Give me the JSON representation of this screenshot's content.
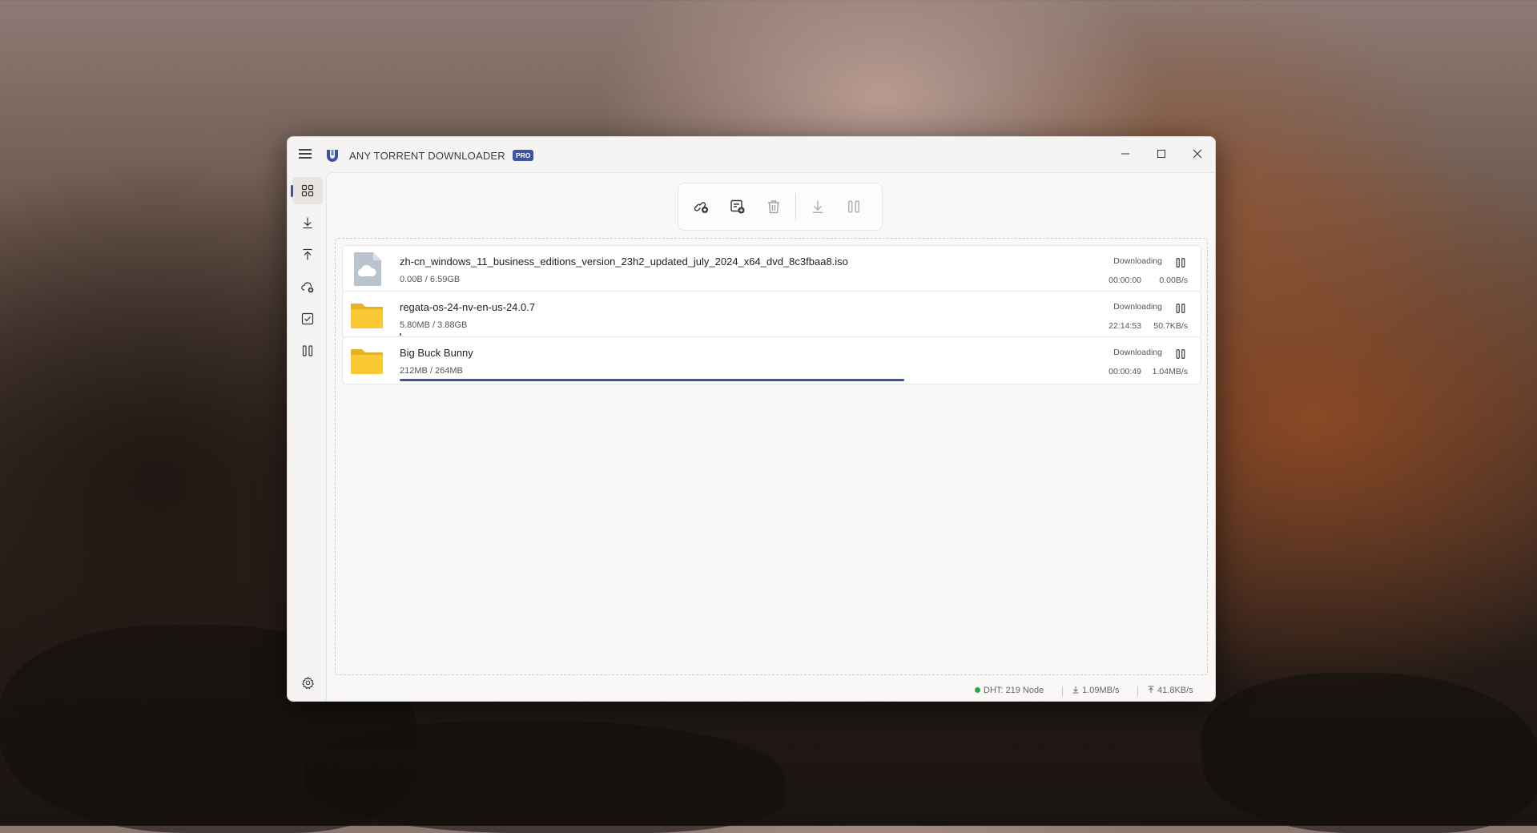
{
  "app": {
    "title": "ANY TORRENT DOWNLOADER",
    "badge": "PRO",
    "accent_color": "#3b54a3"
  },
  "window_controls": [
    "minimize-icon",
    "maximize-icon",
    "close-icon"
  ],
  "sidebar": {
    "items": [
      {
        "id": "all",
        "icon": "grid-icon",
        "active": true
      },
      {
        "id": "downloading",
        "icon": "download-icon",
        "active": false
      },
      {
        "id": "seeding",
        "icon": "upload-icon",
        "active": false
      },
      {
        "id": "cloud",
        "icon": "cloud-add-icon",
        "active": false
      },
      {
        "id": "completed",
        "icon": "checkbox-icon",
        "active": false
      },
      {
        "id": "paused",
        "icon": "pause-icon",
        "active": false
      }
    ],
    "settings_icon": "gear-icon"
  },
  "toolbar": {
    "buttons": [
      "add-link-icon",
      "add-file-icon",
      "delete-icon",
      "resume-all-icon",
      "pause-all-icon"
    ]
  },
  "torrents": [
    {
      "name": "zh-cn_windows_11_business_editions_version_23h2_updated_july_2024_x64_dvd_8c3fbaa8.iso",
      "downloaded": "0.00B",
      "total": "6.59GB",
      "status": "Downloading",
      "eta": "00:00:00",
      "speed": "0.00B/s",
      "progress": 0,
      "icon": "cloud-file-icon"
    },
    {
      "name": "regata-os-24-nv-en-us-24.0.7",
      "downloaded": "5.80MB",
      "total": "3.88GB",
      "status": "Downloading",
      "eta": "22:14:53",
      "speed": "50.7KB/s",
      "progress": 0.0015,
      "icon": "folder-icon"
    },
    {
      "name": "Big Buck Bunny",
      "downloaded": "212MB",
      "total": "264MB",
      "status": "Downloading",
      "eta": "00:00:49",
      "speed": "1.04MB/s",
      "progress": 0.8,
      "icon": "folder-icon"
    }
  ],
  "statusbar": {
    "dht": "DHT: 219 Node",
    "down_speed": "1.09MB/s",
    "up_speed": "41.8KB/s"
  }
}
